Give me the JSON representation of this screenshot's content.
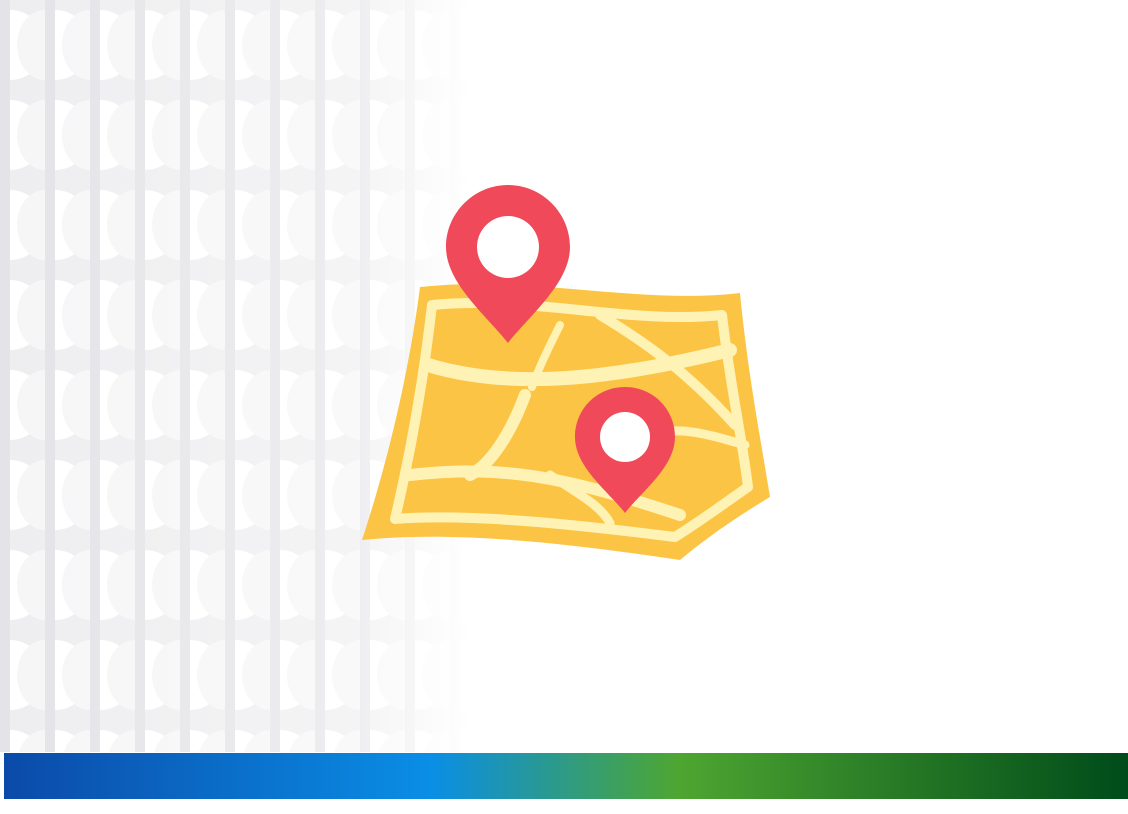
{
  "colors": {
    "background": "#ffffff",
    "map_fill": "#fcc444",
    "map_roads": "#fff2b5",
    "pin": "#f04a5a",
    "pin_hole": "#ffffff",
    "pattern_light": "#f2f2f3",
    "pattern_dark": "#e6e6e9",
    "bar_blue_dark": "#0b4aa8",
    "bar_blue_light": "#0a8ee6",
    "bar_green": "#4ea631",
    "bar_green_dark": "#004b1a"
  },
  "icons": {
    "map": "folded-map-icon",
    "pin": "location-pin-icon"
  }
}
